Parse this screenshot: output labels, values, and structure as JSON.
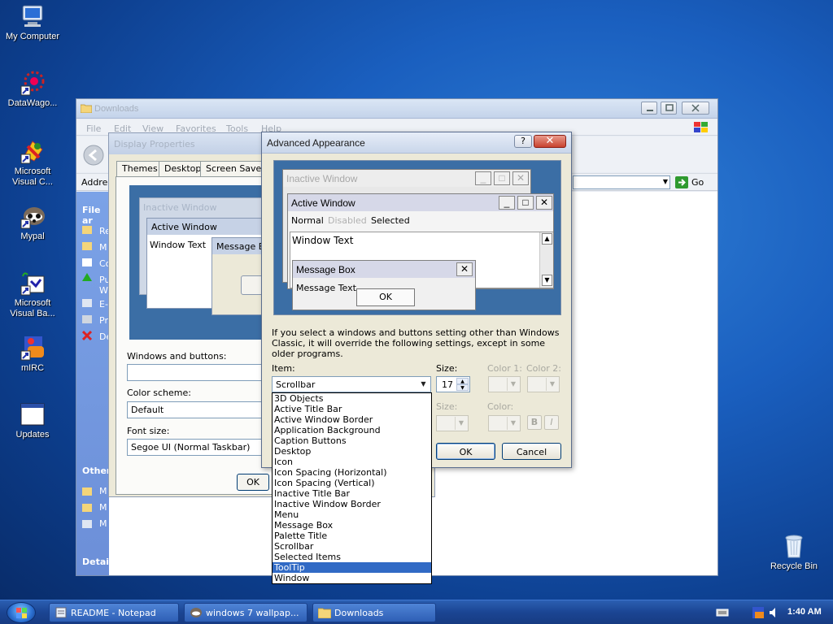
{
  "desktop": {
    "icons": [
      {
        "label": "My Computer"
      },
      {
        "label": "DataWago..."
      },
      {
        "label": "Microsoft\nVisual C..."
      },
      {
        "label": "Mypal"
      },
      {
        "label": "Microsoft\nVisual Ba..."
      },
      {
        "label": "mIRC"
      },
      {
        "label": "Updates"
      },
      {
        "label": "Recycle Bin"
      }
    ]
  },
  "downloads": {
    "title": "Downloads",
    "menu": [
      "File",
      "Edit",
      "View",
      "Favorites",
      "Tools",
      "Help"
    ],
    "address_label": "Addre",
    "go_label": "Go",
    "taskpane": {
      "file_header": "File ar",
      "other_header": "Other",
      "details_header": "Detail",
      "items": [
        "Re",
        "M",
        "Co",
        "Pu\nW",
        "E-",
        "Pr",
        "De"
      ],
      "other_items": [
        "M",
        "M",
        "M"
      ]
    }
  },
  "display_properties": {
    "title": "Display Properties",
    "tabs": [
      "Themes",
      "Desktop",
      "Screen Saver"
    ],
    "preview": {
      "inactive": "Inactive Window",
      "active": "Active Window",
      "window_text": "Window Text",
      "message_box": "Message B"
    },
    "windows_buttons_label": "Windows and buttons:",
    "color_scheme_label": "Color scheme:",
    "color_scheme_value": "Default",
    "font_size_label": "Font size:",
    "font_size_value": "Segoe UI (Normal Taskbar)",
    "ok_label": "OK"
  },
  "advanced": {
    "title": "Advanced Appearance",
    "help_label": "?",
    "preview": {
      "inactive_title": "Inactive Window",
      "active_title": "Active Window",
      "menu_normal": "Normal",
      "menu_disabled": "Disabled",
      "menu_selected": "Selected",
      "window_text": "Window Text",
      "msgbox_title": "Message Box",
      "msgbox_text": "Message Text",
      "msgbox_ok": "OK"
    },
    "note": "If you select a windows and buttons setting other than Windows Classic, it will override the following settings, except in some older programs.",
    "item_label": "Item:",
    "item_value": "Scrollbar",
    "size_label": "Size:",
    "size_value": "17",
    "color1_label": "Color 1:",
    "color2_label": "Color 2:",
    "font_size_label": "Size:",
    "font_color_label": "Color:",
    "bold_label": "B",
    "italic_label": "I",
    "ok_label": "OK",
    "cancel_label": "Cancel",
    "item_options": [
      "3D Objects",
      "Active Title Bar",
      "Active Window Border",
      "Application Background",
      "Caption Buttons",
      "Desktop",
      "Icon",
      "Icon Spacing (Horizontal)",
      "Icon Spacing (Vertical)",
      "Inactive Title Bar",
      "Inactive Window Border",
      "Menu",
      "Message Box",
      "Palette Title",
      "Scrollbar",
      "Selected Items",
      "ToolTip",
      "Window"
    ],
    "highlighted_option": "ToolTip"
  },
  "taskbar": {
    "buttons": [
      {
        "label": "README - Notepad"
      },
      {
        "label": "windows 7 wallpap..."
      },
      {
        "label": "Downloads"
      }
    ],
    "clock": "1:40 AM"
  },
  "colors": {
    "selection": "#316ac5",
    "preview_bg": "#3b6ea5",
    "dialog_face": "#ece9d8"
  }
}
